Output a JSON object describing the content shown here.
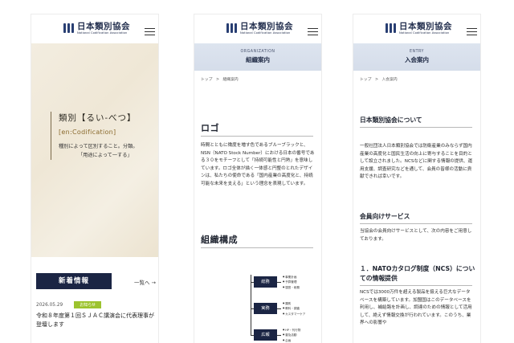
{
  "logo": {
    "title": "日本類別協会",
    "subtitle": "National Codification Association"
  },
  "home": {
    "hero": {
      "word": "類別【るい-べつ】",
      "en": "[en:Codification]",
      "desc1": "種別によって区別すること。分類。",
      "desc2": "「用途によって一する」"
    },
    "news_title": "新着情報",
    "news_more": "一覧へ →",
    "news": [
      {
        "date": "2026.05.29",
        "tag": "お知らせ",
        "title": "令和８年度第１回ＳＪＡＣ講演会に代表理事が登壇します"
      }
    ]
  },
  "organization": {
    "banner_en": "ORGANIZATION",
    "banner_ja": "組織案内",
    "breadcrumb": [
      "トップ",
      ">",
      "組織案内"
    ],
    "logo_heading": "ロゴ",
    "logo_text": "時間とともに徴度を増す色であるブルーブラックと、NSN（NATO Stock Number）における日本の番号である３０をモチーフとして「持続可能性と円熟」を意味しています。ロゴ全体が描く一体感と円整のとれたデザインは、私たちの使命である「国内産業の高度化と、持続可能な未来を支える」という理念を表現しています。",
    "structure_heading": "組織構成",
    "departments": [
      {
        "name": "総務",
        "items": [
          "事業計画",
          "予算管理",
          "運営・総務"
        ]
      },
      {
        "name": "実務",
        "items": [
          "類別",
          "教科・調査",
          "カスタマーケア"
        ]
      },
      {
        "name": "広報",
        "items": [
          "HP・刊行物",
          "普及活動",
          "企画"
        ]
      }
    ]
  },
  "entry": {
    "banner_en": "ENTRY",
    "banner_ja": "入会案内",
    "breadcrumb": [
      "トップ",
      ">",
      "入会案内"
    ],
    "about_heading": "日本類別協会について",
    "about_text": "一般社団法人日本類別協会では防衛産業のみならず国内産業の高度化と国民生活の向上に寄与することを目的として設立されました。NCSなどに関する情報の提供、運用支援、調査研究などを通して、会員の皆様の活動に貢献できれば幸いです。",
    "services_heading": "会員向けサービス",
    "services_text": "当協会の会員向けサービスとして、次の内容をご用意しております。",
    "item1_heading": "１．NATOカタログ制度（NCS）についての情報提供",
    "item1_text": "NCSでは3000万件を超える製品を扱える巨大なデータベースを構築しています。加盟国はこのデータベースを利用し、補給路を計画し、調達のための情報として活用して、絶えず情報交換が行われています。このうち、業界への影響や"
  }
}
